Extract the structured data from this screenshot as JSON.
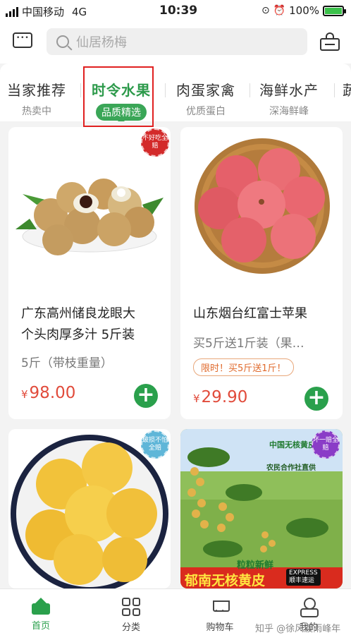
{
  "status": {
    "carrier": "中国移动",
    "network": "4G",
    "time": "10:39",
    "battery": "100%"
  },
  "header": {
    "search_placeholder": "仙居杨梅"
  },
  "tabs": [
    {
      "title": "当家推荐",
      "subtitle": "热卖中"
    },
    {
      "title": "时令水果",
      "subtitle": "品质精选"
    },
    {
      "title": "肉蛋家禽",
      "subtitle": "优质蛋白"
    },
    {
      "title": "海鲜水产",
      "subtitle": "深海鲜峰"
    },
    {
      "title": "蔬",
      "subtitle": ""
    }
  ],
  "products": [
    {
      "title_line1": "广东高州储良龙眼大",
      "title_line2": "个头肉厚多汁 5斤装",
      "subtitle": "5斤（带枝重量）",
      "currency": "¥",
      "price": "98.00",
      "badge": "不好吃全赔"
    },
    {
      "title_line1": "山东烟台红富士苹果",
      "subtitle": "买5斤送1斤装（果…",
      "promo": "限时！买5斤送1斤！",
      "currency": "¥",
      "price": "29.90"
    },
    {
      "badge": "破损不怕全赔"
    },
    {
      "banner_top": "中国无核黄皮",
      "banner_sub": "农民合作社直供",
      "banner_slogan": "粒粒新鲜",
      "banner_bottom": "郁南无核黄皮",
      "express": "EXPRESS",
      "express_cn": "顺丰速运",
      "badge": "坏一赔全赔"
    }
  ],
  "tabbar": [
    {
      "label": "首页"
    },
    {
      "label": "分类"
    },
    {
      "label": "购物车"
    },
    {
      "label": "我的"
    }
  ],
  "watermark": "知乎 @徐风渡雨峰年",
  "colors": {
    "accent": "#2aa04c",
    "price": "#e14b3b",
    "highlight_box": "#e02020"
  }
}
